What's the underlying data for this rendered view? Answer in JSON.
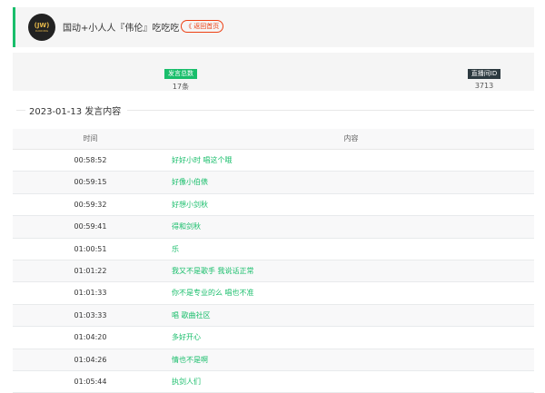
{
  "header": {
    "avatar_text_top": "(JW)",
    "avatar_text_bottom": "DANCING",
    "title": "国动+小人人『伟伦』吃吃吃",
    "back_label": "《 返回首页"
  },
  "stats": {
    "count_label": "发言总数",
    "count_value": "17条",
    "room_label": "直播间ID",
    "room_value": "3713"
  },
  "section": {
    "title": "2023-01-13 发言内容"
  },
  "table": {
    "headers": {
      "time": "时间",
      "content": "内容"
    },
    "rows": [
      {
        "time": "00:58:52",
        "content": "好好小时 唱这个哦"
      },
      {
        "time": "00:59:15",
        "content": "好像小伯俵"
      },
      {
        "time": "00:59:32",
        "content": "好想小剑秋"
      },
      {
        "time": "00:59:41",
        "content": "得和剑秋"
      },
      {
        "time": "01:00:51",
        "content": "乐"
      },
      {
        "time": "01:01:22",
        "content": "我又不是歌手 我说话正常"
      },
      {
        "time": "01:01:33",
        "content": "你不是专业的么 唱也不准"
      },
      {
        "time": "01:03:33",
        "content": "唱 歌曲社区"
      },
      {
        "time": "01:04:20",
        "content": "多好开心"
      },
      {
        "time": "01:04:26",
        "content": "情也不是啊"
      },
      {
        "time": "01:05:44",
        "content": "执剑人们"
      }
    ]
  }
}
